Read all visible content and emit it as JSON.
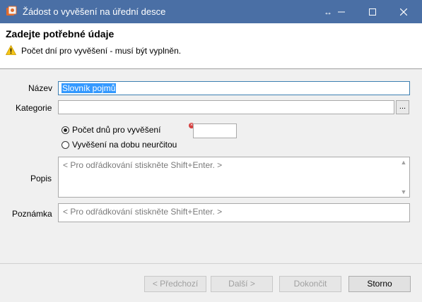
{
  "window": {
    "title": "Žádost o vyvěšení na úřední desce",
    "resize_glyph": "↔",
    "minimize_glyph": "—",
    "maximize_glyph": "☐",
    "close_glyph": "✕"
  },
  "header": {
    "title": "Zadejte potřebné údaje",
    "warning": "Počet dní pro vyvěšení - musí být vyplněn."
  },
  "form": {
    "name_label": "Název",
    "name_value": "Slovník pojmů",
    "category_label": "Kategorie",
    "category_value": "",
    "browse_label": "...",
    "radio_days_label": "Počet dnů pro vyvěšení",
    "radio_days_checked": true,
    "radio_indefinite_label": "Vyvěšení na dobu neurčitou",
    "radio_indefinite_checked": false,
    "days_value": "",
    "description_label": "Popis",
    "description_placeholder": "< Pro odřádkování stiskněte Shift+Enter. >",
    "note_label": "Poznámka",
    "note_placeholder": "< Pro odřádkování stiskněte Shift+Enter. >"
  },
  "buttons": {
    "previous": "< Předchozí",
    "next": "Další >",
    "finish": "Dokončit",
    "cancel": "Storno"
  },
  "icons": {
    "app": "wizard-app-icon",
    "warning": "warning-icon",
    "error": "error-icon"
  }
}
